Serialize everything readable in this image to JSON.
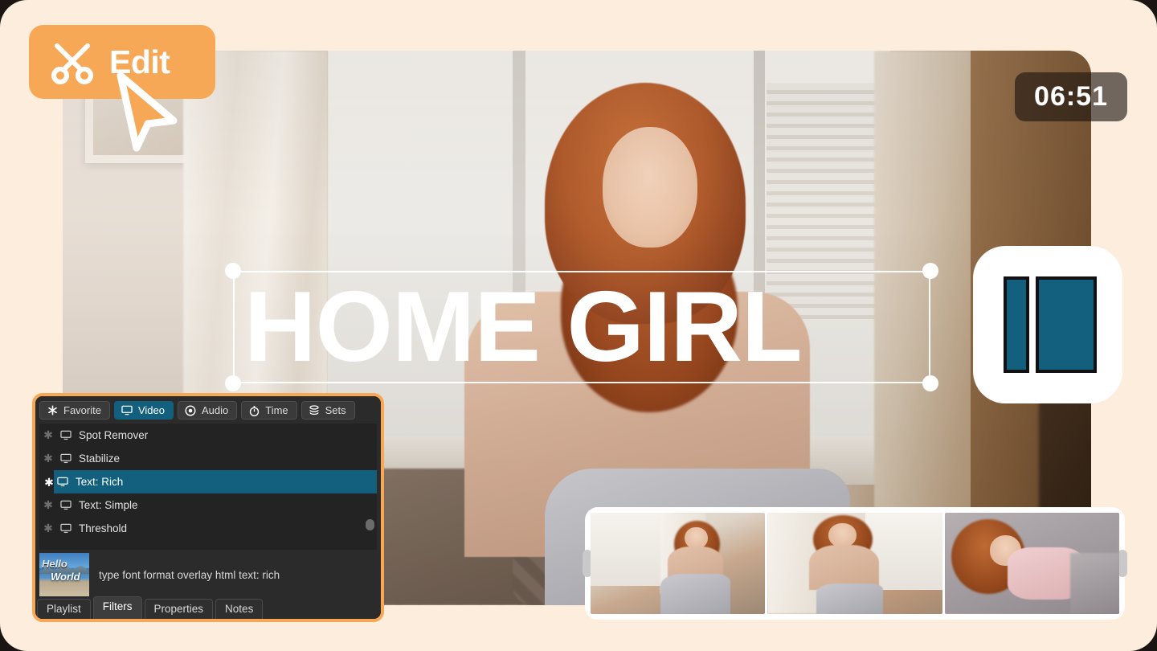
{
  "app": {
    "name": "Shotcut",
    "logo_icon": "shotcut-logo-icon"
  },
  "badge": {
    "label": "Edit",
    "icon": "scissors-icon",
    "cursor_icon": "cursor-arrow-icon",
    "color": "#f7a857"
  },
  "player": {
    "timecode": "06:51"
  },
  "title_overlay": {
    "text": "HOME GIRL",
    "handles": [
      "top-left",
      "top-right",
      "bottom-left",
      "bottom-right"
    ]
  },
  "filters_panel": {
    "category_tabs": [
      {
        "label": "Favorite",
        "icon": "asterisk-icon",
        "active": false
      },
      {
        "label": "Video",
        "icon": "monitor-icon",
        "active": true
      },
      {
        "label": "Audio",
        "icon": "audio-disc-icon",
        "active": false
      },
      {
        "label": "Time",
        "icon": "stopwatch-icon",
        "active": false
      },
      {
        "label": "Sets",
        "icon": "stack-icon",
        "active": false
      }
    ],
    "filters": [
      {
        "name": "Spot Remover",
        "favorite": false,
        "selected": false,
        "icon": "monitor-icon"
      },
      {
        "name": "Stabilize",
        "favorite": false,
        "selected": false,
        "icon": "monitor-icon"
      },
      {
        "name": "Text: Rich",
        "favorite": true,
        "selected": true,
        "icon": "monitor-icon"
      },
      {
        "name": "Text: Simple",
        "favorite": false,
        "selected": false,
        "icon": "monitor-icon"
      },
      {
        "name": "Threshold",
        "favorite": false,
        "selected": false,
        "icon": "monitor-icon"
      }
    ],
    "preview": {
      "thumb_line1": "Hello",
      "thumb_line2": "World",
      "description": "type font format overlay html text: rich"
    },
    "bottom_tabs": [
      {
        "label": "Playlist",
        "active": false
      },
      {
        "label": "Filters",
        "active": true
      },
      {
        "label": "Properties",
        "active": false
      },
      {
        "label": "Notes",
        "active": false
      }
    ],
    "accent_color": "#12607d",
    "border_color": "#f7a857"
  },
  "filmstrip": {
    "thumbnails": [
      "clip-1",
      "clip-2",
      "clip-3"
    ],
    "handle_left": "trim-handle-left",
    "handle_right": "trim-handle-right"
  },
  "theme": {
    "background": "#fdeddc",
    "panel_bg": "#2b2b2b",
    "accent": "#12607d",
    "orange": "#f7a857"
  }
}
